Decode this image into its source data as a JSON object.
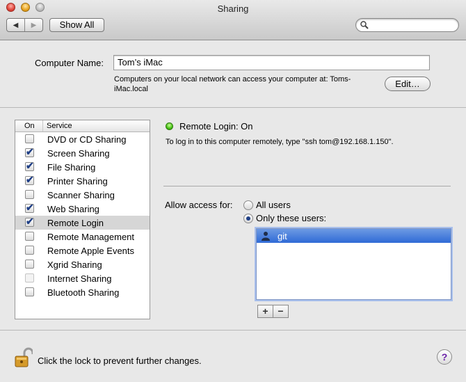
{
  "window": {
    "title": "Sharing"
  },
  "toolbar": {
    "back_glyph": "◀",
    "forward_glyph": "▶",
    "show_all_label": "Show All",
    "search_placeholder": ""
  },
  "computer_name": {
    "label": "Computer Name:",
    "value": "Tom’s iMac",
    "description": "Computers on your local network can access your computer at: Toms-iMac.local",
    "edit_label": "Edit…"
  },
  "services": {
    "header_on": "On",
    "header_service": "Service",
    "items": [
      {
        "label": "DVD or CD Sharing",
        "checked": false,
        "enabled": true,
        "selected": false
      },
      {
        "label": "Screen Sharing",
        "checked": true,
        "enabled": true,
        "selected": false
      },
      {
        "label": "File Sharing",
        "checked": true,
        "enabled": true,
        "selected": false
      },
      {
        "label": "Printer Sharing",
        "checked": true,
        "enabled": true,
        "selected": false
      },
      {
        "label": "Scanner Sharing",
        "checked": false,
        "enabled": true,
        "selected": false
      },
      {
        "label": "Web Sharing",
        "checked": true,
        "enabled": true,
        "selected": false
      },
      {
        "label": "Remote Login",
        "checked": true,
        "enabled": true,
        "selected": true
      },
      {
        "label": "Remote Management",
        "checked": false,
        "enabled": true,
        "selected": false
      },
      {
        "label": "Remote Apple Events",
        "checked": false,
        "enabled": true,
        "selected": false
      },
      {
        "label": "Xgrid Sharing",
        "checked": false,
        "enabled": true,
        "selected": false
      },
      {
        "label": "Internet Sharing",
        "checked": false,
        "enabled": false,
        "selected": false
      },
      {
        "label": "Bluetooth Sharing",
        "checked": false,
        "enabled": true,
        "selected": false
      }
    ]
  },
  "detail": {
    "status": "Remote Login: On",
    "status_color": "#45c012",
    "hint": "To log in to this computer remotely, type \"ssh tom@192.168.1.150\".",
    "access_label": "Allow access for:",
    "option_all": "All users",
    "option_only": "Only these users:",
    "selected_option": "only",
    "users": [
      {
        "name": "git"
      }
    ],
    "add_label": "+",
    "remove_label": "−"
  },
  "footer": {
    "lock_text": "Click the lock to prevent further changes.",
    "help_label": "?"
  },
  "colors": {
    "selection": "#2f6ad6",
    "checkmark": "#1f3f86"
  }
}
